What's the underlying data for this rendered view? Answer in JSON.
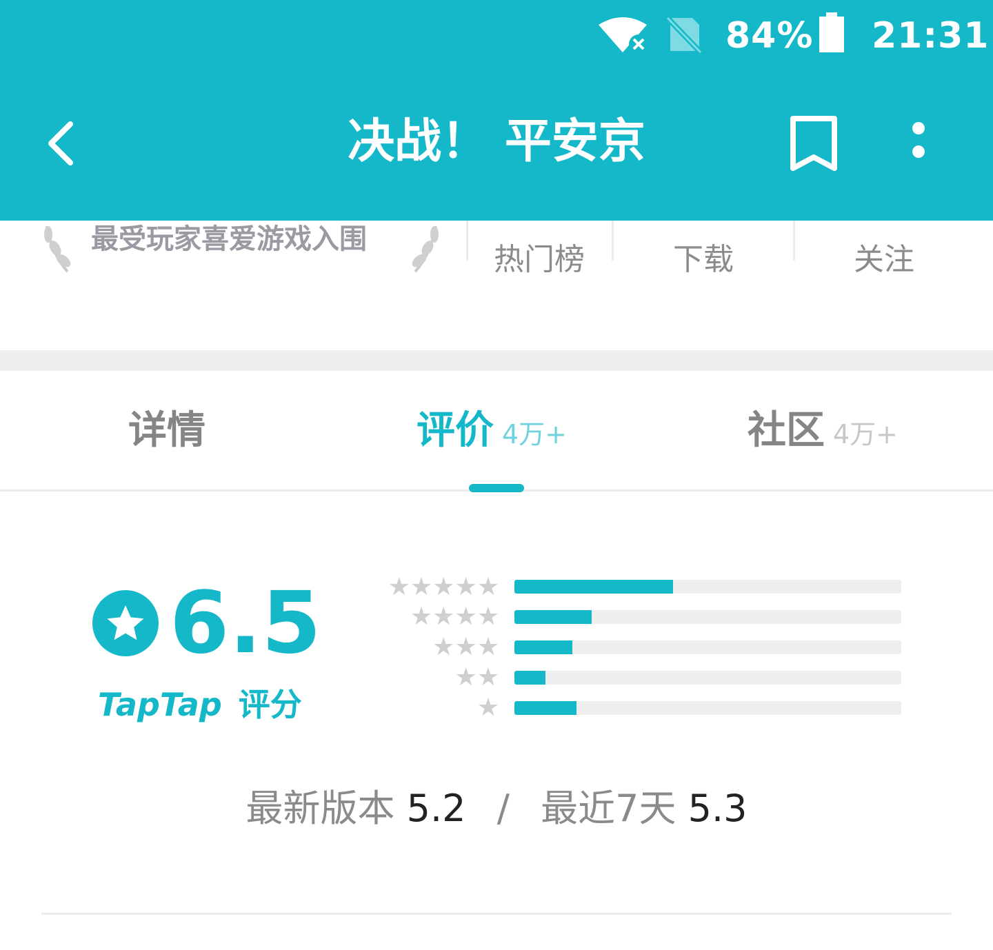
{
  "colors": {
    "accent": "#15b8c8",
    "bar_track": "#eeeeee",
    "muted_text": "#8b8b8b"
  },
  "status_bar": {
    "battery": "84%",
    "time": "21:31",
    "icons": [
      "wifi-off-icon",
      "no-sim-icon",
      "battery-icon"
    ]
  },
  "app_bar": {
    "title": "决战！ 平安京",
    "icons": [
      "back-arrow-icon",
      "bookmark-icon",
      "more-vertical-icon"
    ]
  },
  "stats": {
    "award": "最受玩家喜爱游戏入围",
    "items": [
      {
        "label": "热门榜"
      },
      {
        "label": "下载"
      },
      {
        "label": "关注"
      }
    ]
  },
  "tabs": [
    {
      "label": "详情",
      "count": ""
    },
    {
      "label": "评价",
      "count": "4万+",
      "active": true
    },
    {
      "label": "社区",
      "count": "4万+"
    }
  ],
  "rating": {
    "score": "6.5",
    "brand": "TapTap",
    "caption": "评分",
    "distribution": [
      {
        "stars": 5,
        "fraction": 0.41
      },
      {
        "stars": 4,
        "fraction": 0.2
      },
      {
        "stars": 3,
        "fraction": 0.15
      },
      {
        "stars": 2,
        "fraction": 0.08
      },
      {
        "stars": 1,
        "fraction": 0.16
      }
    ],
    "latest_version_label": "最新版本",
    "latest_version_score": "5.2",
    "separator": "/",
    "recent_label": "最近7天",
    "recent_score": "5.3"
  }
}
